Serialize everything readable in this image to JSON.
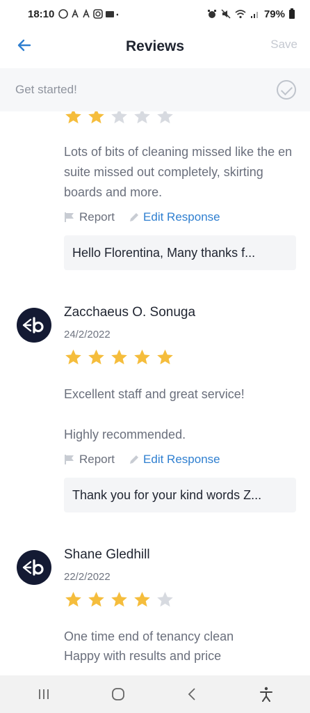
{
  "status_bar": {
    "time": "18:10",
    "notification_icons": "◌⁠ ⁠⁠",
    "battery": "79%"
  },
  "header": {
    "title": "Reviews",
    "save_label": "Save"
  },
  "get_started": {
    "label": "Get started!"
  },
  "reviews": [
    {
      "stars": 2,
      "text": "Lots of bits of cleaning missed like the en suite missed out completely, skirting boards and more.",
      "report_label": "Report",
      "edit_label": "Edit Response",
      "response": "Hello Florentina,   Many thanks f..."
    },
    {
      "name": "Zacchaeus O. Sonuga",
      "date": "24/2/2022",
      "stars": 5,
      "text": "Excellent staff and great service!",
      "text2": "Highly recommended.",
      "report_label": "Report",
      "edit_label": "Edit Response",
      "response": "Thank you for your kind words Z..."
    },
    {
      "name": "Shane Gledhill",
      "date": "22/2/2022",
      "stars": 4,
      "text": "One time end of tenancy clean",
      "text2": "Happy with results and price"
    }
  ],
  "colors": {
    "star_filled": "#f5bd3c",
    "star_empty": "#d7dae0",
    "accent": "#2f7fd0",
    "avatar_bg": "#141a33"
  }
}
